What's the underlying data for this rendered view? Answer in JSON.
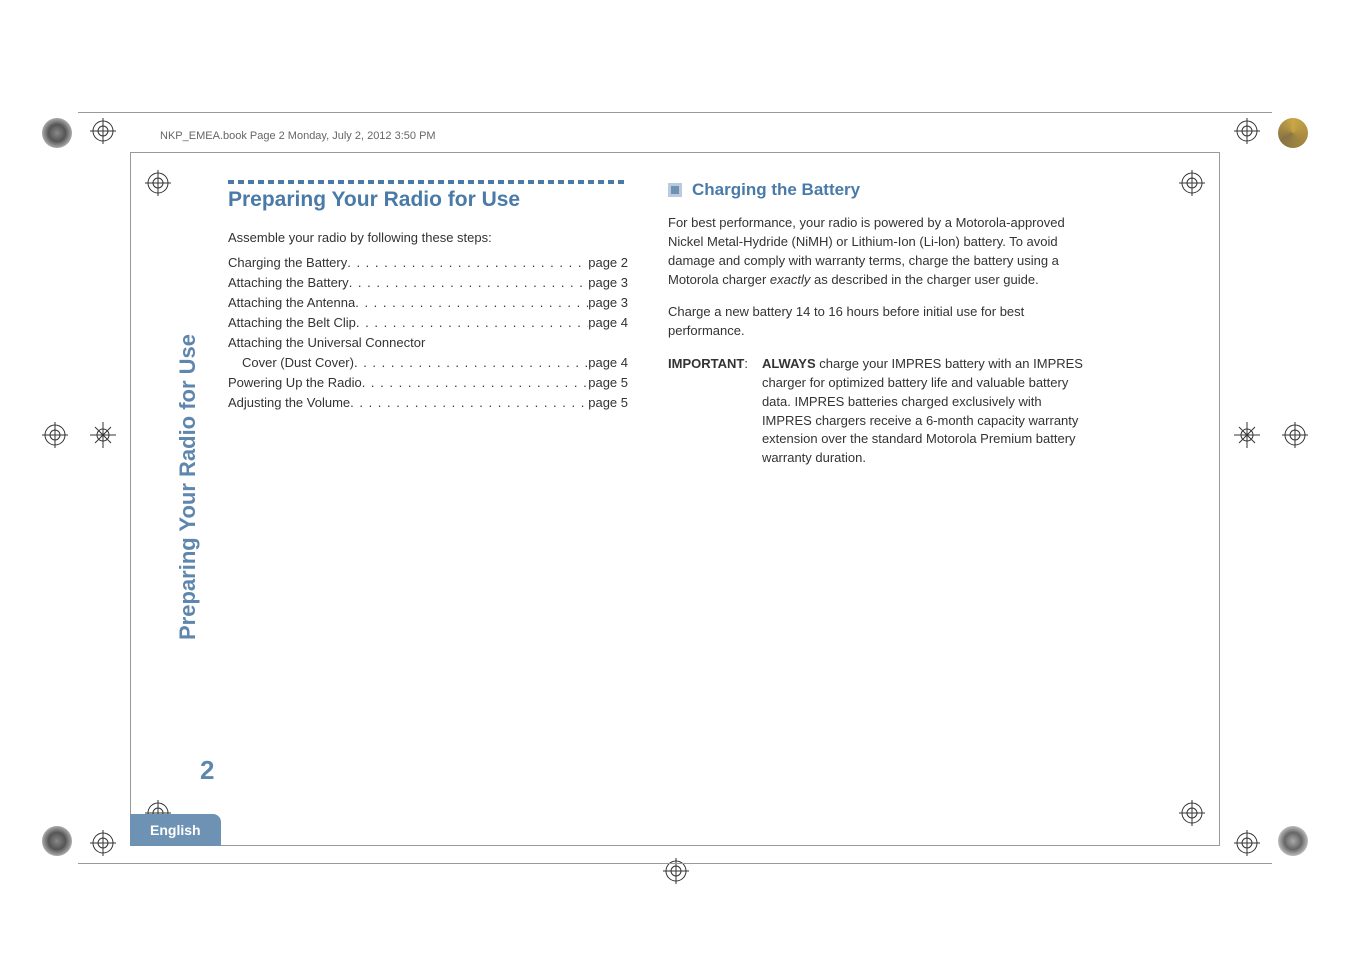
{
  "header": {
    "running_head": "NKP_EMEA.book  Page 2  Monday, July 2, 2012  3:50 PM"
  },
  "left": {
    "title": "Preparing Your Radio for Use",
    "intro": "Assemble your radio by following these steps:",
    "toc": [
      {
        "label": "Charging the Battery",
        "page": "page 2"
      },
      {
        "label": "Attaching the Battery",
        "page": "page 3"
      },
      {
        "label": "Attaching the Antenna",
        "page": "page 3"
      },
      {
        "label": "Attaching the Belt Clip",
        "page": "page 4"
      },
      {
        "label": "Attaching the Universal Connector",
        "page": ""
      },
      {
        "label": "Cover (Dust Cover)",
        "page": "page 4",
        "indent": true
      },
      {
        "label": "Powering Up the Radio",
        "page": "page 5"
      },
      {
        "label": "Adjusting the Volume",
        "page": "page 5"
      }
    ]
  },
  "right": {
    "subtitle": "Charging the Battery",
    "para1_a": "For best performance, your radio is powered by a Motorola-approved Nickel Metal-Hydride (NiMH) or Lithium-Ion (Li-lon) battery. To avoid damage and comply with warranty terms, charge the battery using a Motorola charger ",
    "para1_b": "exactly",
    "para1_c": " as described in the charger user guide.",
    "para2": "Charge a new battery 14 to 16 hours before initial use for best performance.",
    "important_label": "IMPORTANT",
    "important_colon": ":",
    "important_body_a": "ALWAYS",
    "important_body_b": " charge your IMPRES battery with an IMPRES charger for optimized battery life and valuable battery data. IMPRES batteries charged exclusively with IMPRES chargers receive a 6-month capacity warranty extension over the standard Motorola Premium battery warranty duration."
  },
  "sidebar": {
    "tab_text": "Preparing Your Radio for Use",
    "page_number": "2",
    "language": "English"
  }
}
